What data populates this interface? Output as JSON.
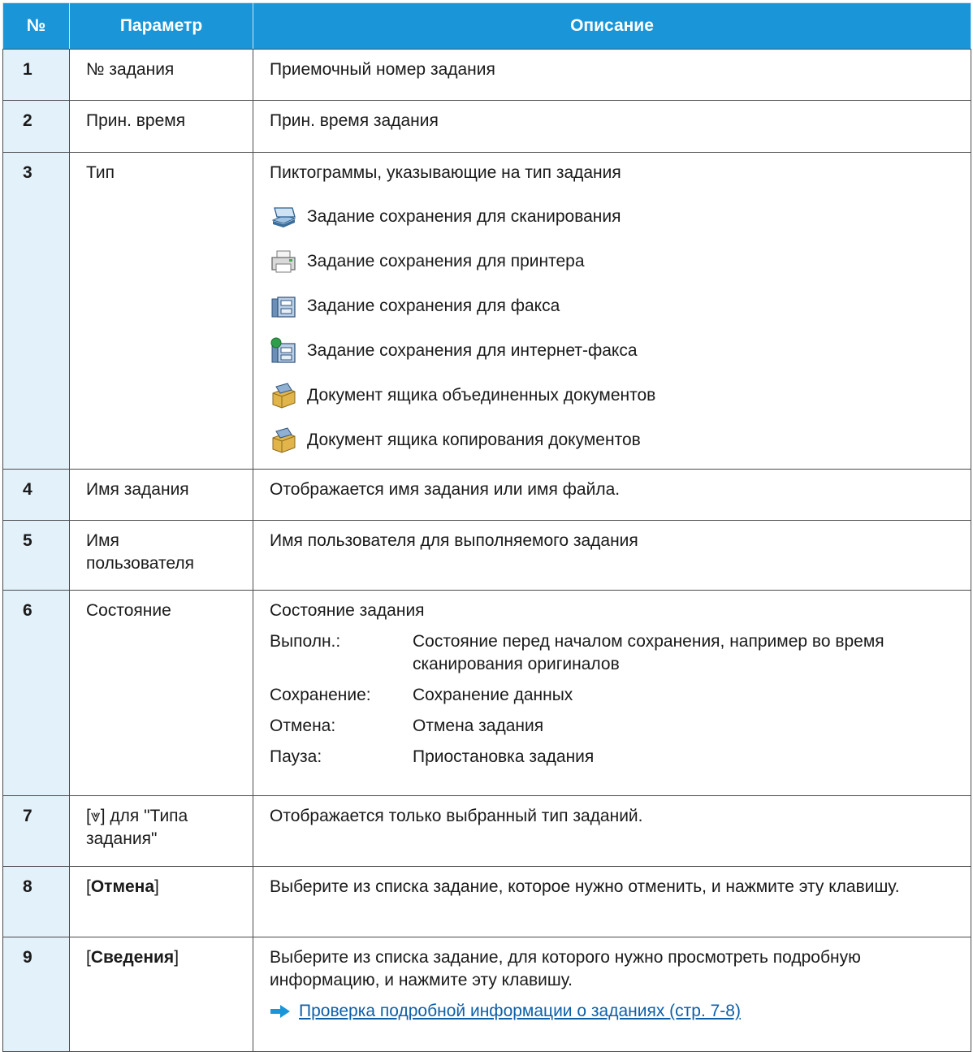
{
  "header": {
    "num": "№",
    "param": "Параметр",
    "desc": "Описание"
  },
  "rows": [
    {
      "num": "1",
      "param": "№ задания",
      "desc": "Приемочный номер задания"
    },
    {
      "num": "2",
      "param": "Прин. время",
      "desc": "Прин. время задания"
    },
    {
      "num": "3",
      "param": "Тип",
      "desc": "Пиктограммы, указывающие на тип задания",
      "types": [
        {
          "icon": "scan-job-icon",
          "label": "Задание сохранения для сканирования"
        },
        {
          "icon": "printer-job-icon",
          "label": "Задание сохранения для принтера"
        },
        {
          "icon": "fax-job-icon",
          "label": "Задание сохранения для факса"
        },
        {
          "icon": "internet-fax-job-icon",
          "label": "Задание сохранения для интернет-факса"
        },
        {
          "icon": "joined-box-icon",
          "label": "Документ ящика объединенных документов"
        },
        {
          "icon": "copy-box-icon",
          "label": "Документ ящика копирования документов"
        }
      ]
    },
    {
      "num": "4",
      "param": "Имя задания",
      "desc": "Отображается имя задания или имя файла."
    },
    {
      "num": "5",
      "param_line1": "Имя",
      "param_line2": "пользователя",
      "desc": "Имя пользователя для выполняемого задания"
    },
    {
      "num": "6",
      "param": "Состояние",
      "desc": "Состояние задания",
      "states": [
        {
          "key": "Выполн.:",
          "val": "Состояние перед началом сохранения, например во время сканирования оригиналов"
        },
        {
          "key": "Сохранение:",
          "val": "Сохранение данных"
        },
        {
          "key": "Отмена:",
          "val": "Отмена задания"
        },
        {
          "key": "Пауза:",
          "val": "Приостановка задания"
        }
      ]
    },
    {
      "num": "7",
      "param_prefix": "[",
      "param_symbol": "⩔",
      "param_suffix": "] для \"Типа задания\"",
      "desc": "Отображается только выбранный тип заданий."
    },
    {
      "num": "8",
      "param_open": "[",
      "param_bold": "Отмена",
      "param_close": "]",
      "desc": "Выберите из списка задание, которое нужно отменить, и нажмите эту клавишу."
    },
    {
      "num": "9",
      "param_open": "[",
      "param_bold": "Сведения",
      "param_close": "]",
      "desc": "Выберите из списка задание, для которого нужно просмотреть подробную информацию, и нажмите эту клавишу.",
      "link": "Проверка подробной информации о заданиях (стр. 7-8)"
    }
  ]
}
